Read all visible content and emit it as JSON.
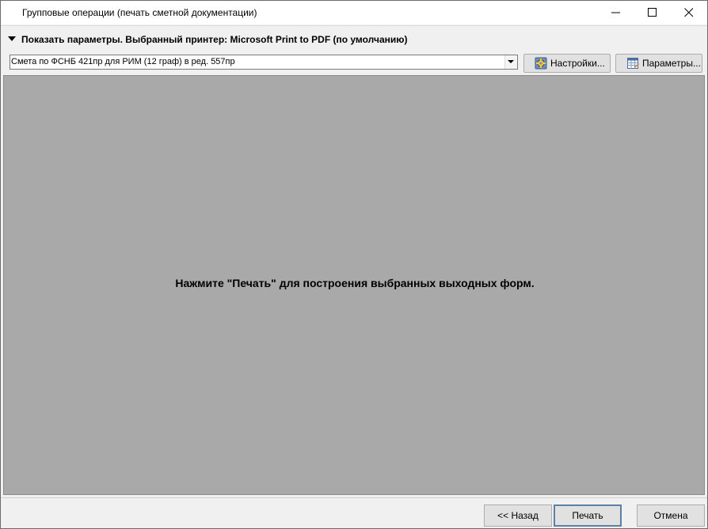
{
  "window": {
    "title": "Групповые операции (печать сметной документации)"
  },
  "params_bar": {
    "text": "Показать параметры. Выбранный принтер: Microsoft Print to PDF (по умолчанию)"
  },
  "toolbar": {
    "form_select_value": "Смета по ФСНБ 421пр для РИМ (12 граф) в ред. 557пр",
    "settings_label": "Настройки...",
    "parameters_label": "Параметры..."
  },
  "preview": {
    "message": "Нажмите \"Печать\" для построения выбранных выходных форм."
  },
  "footer": {
    "back_label": "<< Назад",
    "print_label": "Печать",
    "cancel_label": "Отмена"
  },
  "icons": {
    "minimize": "minimize-icon",
    "maximize": "maximize-icon",
    "close": "close-icon",
    "settings": "gear-settings-icon",
    "parameters": "table-parameters-icon",
    "toggle": "triangle-down-icon",
    "dropdown": "dropdown-arrow-icon"
  },
  "colors": {
    "preview_background": "#a9a9a9",
    "window_background": "#f0f0f0",
    "default_button_border": "#5c7fa6"
  }
}
